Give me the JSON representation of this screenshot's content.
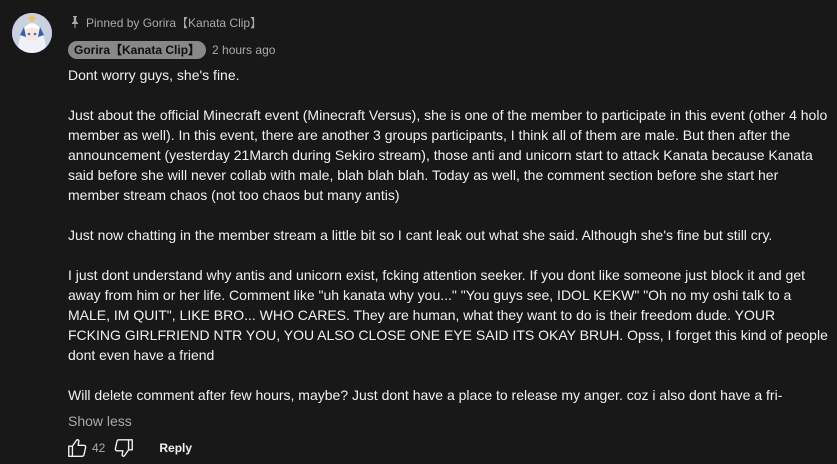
{
  "comment": {
    "pinned_text": "Pinned by Gorira【Kanata Clip】",
    "author": "Gorira【Kanata Clip】",
    "timestamp": "2 hours ago",
    "paragraphs": [
      "Dont worry guys, she's fine.",
      "Just about the official Minecraft event (Minecraft Versus), she is one of the member to participate in this event (other 4 holo member as well). In this event, there are another 3 groups participants, I think all of them are male. But then after the announcement (yesterday 21March during Sekiro stream), those anti and unicorn start to attack Kanata because Kanata said before she will never collab with male, blah blah blah. Today as well, the comment section before she start her member stream chaos (not too chaos but many antis)",
      "Just now chatting in the member stream a little bit so I cant leak out what she said. Although she's fine but still cry.",
      "I just dont understand why antis and unicorn exist, fcking attention seeker. If you dont like someone just block it and get away from him or her life. Comment like \"uh kanata why you...\" \"You guys see, IDOL KEKW\" \"Oh no my oshi talk to a MALE, IM QUIT\", LIKE BRO... WHO CARES. They are human, what they want to do is their freedom dude. YOUR FCKING GIRLFRIEND NTR YOU, YOU ALSO CLOSE ONE EYE SAID ITS OKAY BRUH. Opss, I forget this kind of people dont even have a friend",
      "Will delete comment after few hours, maybe? Just dont have a place to release my anger. coz i also dont have a fri-"
    ],
    "show_less_label": "Show less",
    "like_count": "42",
    "reply_label": "Reply"
  },
  "icons": {
    "pin": "pin-icon",
    "like": "thumbs-up-icon",
    "dislike": "thumbs-down-icon",
    "avatar": "avatar"
  },
  "colors": {
    "background": "#181818",
    "text": "#f1f1f1",
    "secondary_text": "#aaaaaa",
    "author_chip": "#888888"
  }
}
